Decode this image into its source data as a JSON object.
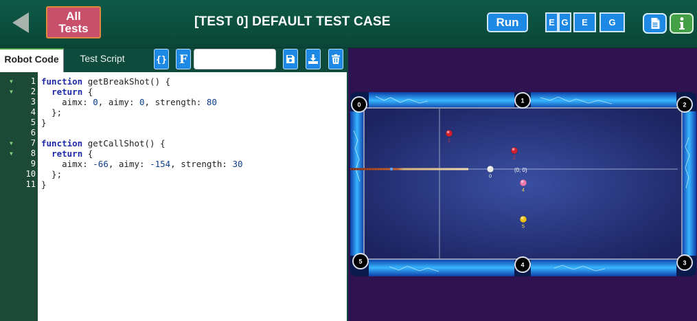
{
  "header": {
    "all_tests_line1": "All",
    "all_tests_line2": "Tests",
    "title": "[TEST 0] DEFAULT TEST CASE",
    "run_label": "Run",
    "mode_buttons": [
      "E",
      "G",
      "E",
      "G"
    ]
  },
  "toolbar": {
    "tabs": [
      "Robot Code",
      "Test Script"
    ],
    "script_name_value": ""
  },
  "editor": {
    "lines": [
      "function getBreakShot() {",
      "  return {",
      "    aimx: 0, aimy: 0, strength: 80",
      "  };",
      "}",
      "",
      "function getCallShot() {",
      "  return {",
      "    aimx: -66, aimy: -154, strength: 30",
      "  };",
      "}"
    ],
    "line_numbers": [
      "1",
      "2",
      "3",
      "4",
      "5",
      "6",
      "7",
      "8",
      "9",
      "10",
      "11"
    ],
    "fold_lines": [
      1,
      2,
      7,
      8
    ]
  },
  "table": {
    "pocket_labels": [
      "0",
      "1",
      "2",
      "3",
      "4",
      "5"
    ],
    "origin_label": "(0, 0)",
    "balls": [
      {
        "label": "0",
        "color": "#e8e8e8",
        "label_color": "#ffffff"
      },
      {
        "label": "1",
        "color": "#d11f2f",
        "label_color": "#e23a3a"
      },
      {
        "label": "2",
        "color": "#d11f2f",
        "label_color": "#e23a3a"
      },
      {
        "label": "4",
        "color": "#f07ab0",
        "label_color": "#ffe04a"
      },
      {
        "label": "5",
        "color": "#f2c418",
        "label_color": "#ffe04a"
      }
    ]
  },
  "colors": {
    "header_bg": "#0f5a47",
    "accent_blue": "#1e88e5",
    "all_tests_bg": "#c9506a",
    "info_green": "#43a047",
    "game_bg": "#2e1350",
    "felt": "#24307a"
  }
}
